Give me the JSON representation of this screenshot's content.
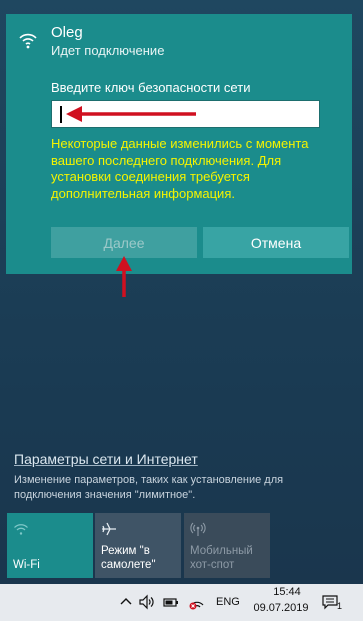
{
  "network": {
    "name": "Oleg",
    "status": "Идет подключение",
    "key_label": "Введите ключ безопасности сети",
    "key_value": "",
    "warning": "Некоторые данные изменились с момента вашего последнего подключения. Для установки соединения требуется дополнительная информация.",
    "next_label": "Далее",
    "cancel_label": "Отмена"
  },
  "settings": {
    "link": "Параметры сети и Интернет",
    "description": "Изменение параметров, таких как установление для подключения значения \"лимитное\"."
  },
  "tiles": [
    {
      "label": "Wi-Fi",
      "icon": "wifi-icon",
      "active": true
    },
    {
      "label": "Режим \"в самолете\"",
      "icon": "airplane-icon",
      "active": false
    },
    {
      "label": "Мобильный хот-спот",
      "icon": "hotspot-icon",
      "active": false
    }
  ],
  "taskbar": {
    "lang": "ENG",
    "time": "15:44",
    "date": "09.07.2019",
    "notification_count": "1"
  },
  "colors": {
    "accent": "#1b8c8c",
    "warning_text": "#f4f400",
    "annotation": "#d01020"
  }
}
